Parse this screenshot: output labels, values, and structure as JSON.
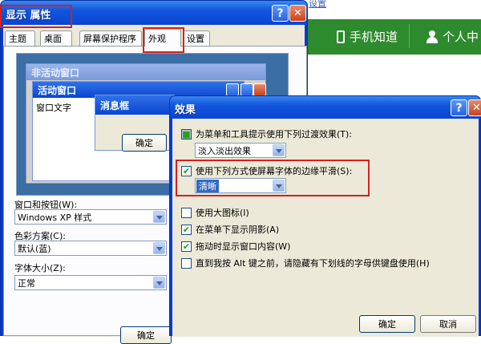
{
  "background_page": {
    "top_link": "设置",
    "nav": [
      {
        "label": "手机知道",
        "icon": "phone-icon"
      },
      {
        "label": "个人中",
        "icon": "person-icon"
      }
    ]
  },
  "display_props": {
    "title": "显示 属性",
    "caption_help": "?",
    "caption_close": "✕",
    "tabs": [
      "主题",
      "桌面",
      "屏幕保护程序",
      "外观",
      "设置"
    ],
    "active_tab": "外观",
    "preview": {
      "inactive_title": "非活动窗口",
      "active_title": "活动窗口",
      "window_text": "窗口文字",
      "msgbox_title": "消息框",
      "ok_label": "确定"
    },
    "fields": {
      "windows_buttons_label": "窗口和按钮(W):",
      "windows_buttons_value": "Windows XP 样式",
      "color_scheme_label": "色彩方案(C):",
      "color_scheme_value": "默认(蓝)",
      "font_size_label": "字体大小(Z):",
      "font_size_value": "正常"
    },
    "bottom_ok": "确定"
  },
  "effects": {
    "title": "效果",
    "caption_help": "?",
    "caption_close": "✕",
    "options": [
      {
        "label": "为菜单和工具提示使用下列过渡效果(T):",
        "checked": true
      },
      {
        "label": "使用下列方式使屏幕字体的边缘平滑(S):",
        "checked": true
      },
      {
        "label": "使用大图标(I)",
        "checked": false
      },
      {
        "label": "在菜单下显示阴影(A)",
        "checked": true
      },
      {
        "label": "拖动时显示窗口内容(W)",
        "checked": true
      },
      {
        "label": "直到我按 Alt 键之前，请隐藏有下划线的字母供键盘使用(H)",
        "checked": false
      }
    ],
    "transition_value": "淡入淡出效果",
    "smoothing_value": "清晰",
    "ok_label": "确定",
    "cancel_label": "取消"
  },
  "colors": {
    "highlight_red": "#d42020",
    "check_green": "#21a121",
    "xp_blue": "#0b45d0",
    "dialog_face": "#ece9d8"
  }
}
